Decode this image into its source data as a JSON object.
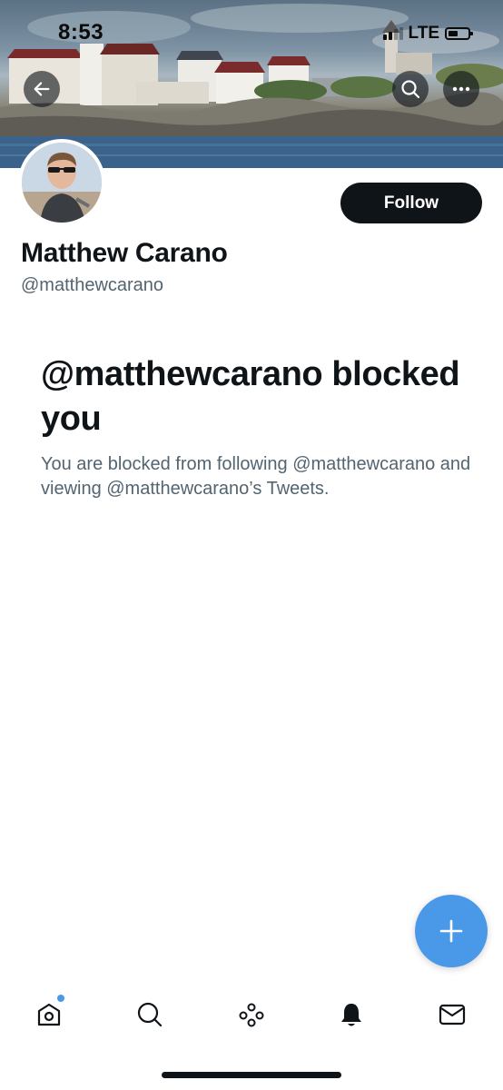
{
  "status_bar": {
    "time": "8:53",
    "network": "LTE"
  },
  "header": {
    "back_icon": "arrow-left-icon",
    "search_icon": "search-icon",
    "more_icon": "more-horizontal-icon"
  },
  "profile": {
    "display_name": "Matthew Carano",
    "handle": "@matthewcarano",
    "follow_label": "Follow"
  },
  "blocked": {
    "title": "@matthewcarano blocked you",
    "message": "You are blocked from following @matthewcarano and viewing @matthewcarano’s Tweets."
  },
  "compose": {
    "icon": "plus-icon"
  },
  "tab_bar": {
    "items": [
      {
        "icon": "home-icon",
        "has_dot": true
      },
      {
        "icon": "search-icon"
      },
      {
        "icon": "spaces-icon"
      },
      {
        "icon": "bell-icon"
      },
      {
        "icon": "mail-icon"
      }
    ]
  },
  "colors": {
    "accent": "#4a99e9",
    "text_primary": "#0f1419",
    "text_secondary": "#536471",
    "button_dark": "#0f1419"
  }
}
